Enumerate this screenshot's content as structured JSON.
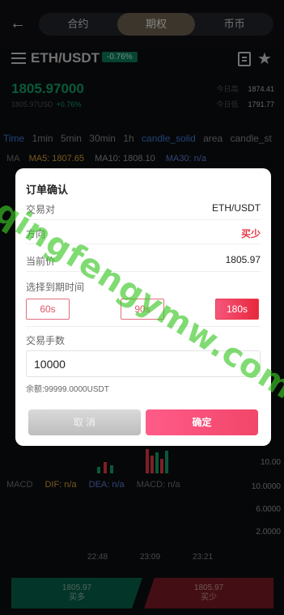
{
  "header": {
    "tabs": [
      {
        "label": "合约",
        "active": false
      },
      {
        "label": "期权",
        "active": true
      },
      {
        "label": "币币",
        "active": false
      }
    ]
  },
  "pair": {
    "title": "ETH/USDT",
    "badge": "-0.76%"
  },
  "ticker": {
    "price": "1805.97000",
    "sub_price": "1805.97USD",
    "change": "+0.76%",
    "high_label": "今日高",
    "high_value": "1874.41",
    "low_label": "今日低",
    "low_value": "1791.77"
  },
  "intervals": [
    "Time",
    "1min",
    "5min",
    "30min",
    "1h",
    "candle_solid",
    "area",
    "candle_st"
  ],
  "ma": {
    "label": "MA",
    "ma5": "MA5: 1807.65",
    "ma10": "MA10: 1808.10",
    "ma30": "MA30: n/a"
  },
  "volume_axis": [
    "10.00",
    "10.0000",
    "6.0000",
    "2.0000"
  ],
  "macd": {
    "label": "MACD",
    "dif": "DIF: n/a",
    "dea": "DEA: n/a",
    "macd": "MACD: n/a"
  },
  "times": [
    "22:48",
    "23:09",
    "23:21"
  ],
  "bottom": {
    "buy_price": "1805.97",
    "buy_label": "买多",
    "sell_price": "1805.97",
    "sell_label": "买少"
  },
  "modal": {
    "title": "订单确认",
    "pair_label": "交易对",
    "pair_value": "ETH/USDT",
    "direction_label": "方向",
    "direction_value": "买少",
    "price_label": "当前价",
    "price_value": "1805.97",
    "expiry_label": "选择到期时间",
    "expiry_options": [
      {
        "label": "60s",
        "selected": false
      },
      {
        "label": "90s",
        "selected": false
      },
      {
        "label": "180s",
        "selected": true
      }
    ],
    "qty_label": "交易手数",
    "qty_value": "10000",
    "balance": "余额:99999.0000USDT",
    "cancel_label": "取 消",
    "confirm_label": "确定"
  },
  "watermark": "qingfengymw.com",
  "colors": {
    "green": "#15a06c",
    "red": "#e63947",
    "accent_blue": "#3d7ad8",
    "confirm": "#f24569"
  }
}
